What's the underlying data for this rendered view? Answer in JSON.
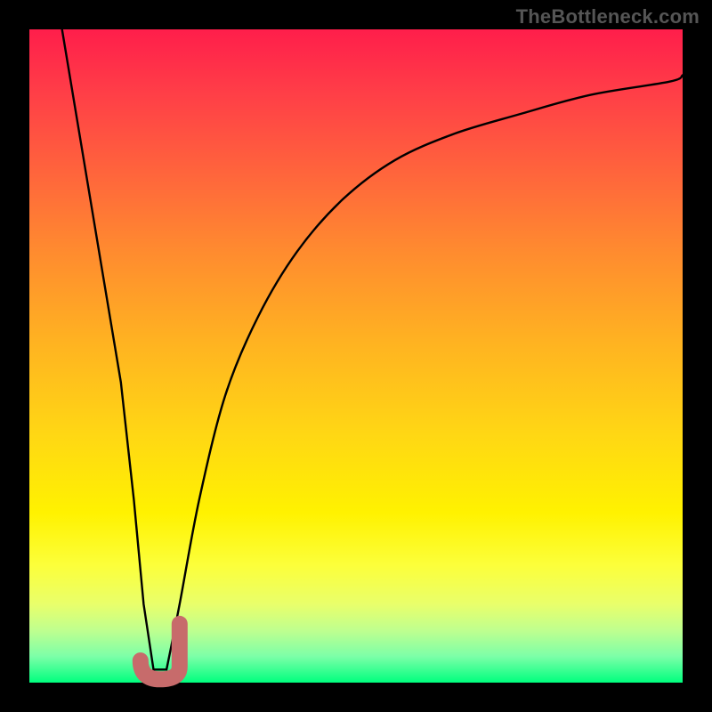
{
  "watermark": "TheBottleneck.com",
  "colors": {
    "frame": "#000000",
    "curve": "#000000",
    "marker": "#c76b6b",
    "gradient_top": "#ff1e4b",
    "gradient_bottom": "#00ff7e"
  },
  "chart_data": {
    "type": "line",
    "title": "",
    "xlabel": "",
    "ylabel": "",
    "xlim": [
      0,
      100
    ],
    "ylim": [
      0,
      100
    ],
    "series": [
      {
        "name": "left-branch",
        "x": [
          5,
          8,
          11,
          14,
          16,
          17.5,
          19
        ],
        "values": [
          100,
          82,
          64,
          46,
          28,
          12,
          2
        ]
      },
      {
        "name": "right-branch",
        "x": [
          21,
          23,
          26,
          30,
          35,
          41,
          48,
          56,
          65,
          75,
          86,
          98,
          100
        ],
        "values": [
          2,
          12,
          28,
          44,
          56,
          66,
          74,
          80,
          84,
          87,
          90,
          92,
          93
        ]
      }
    ],
    "annotations": [
      {
        "name": "j-marker",
        "shape": "J",
        "color": "#c76b6b",
        "x_range": [
          17,
          23
        ],
        "y_range": [
          0.5,
          9
        ]
      }
    ]
  }
}
